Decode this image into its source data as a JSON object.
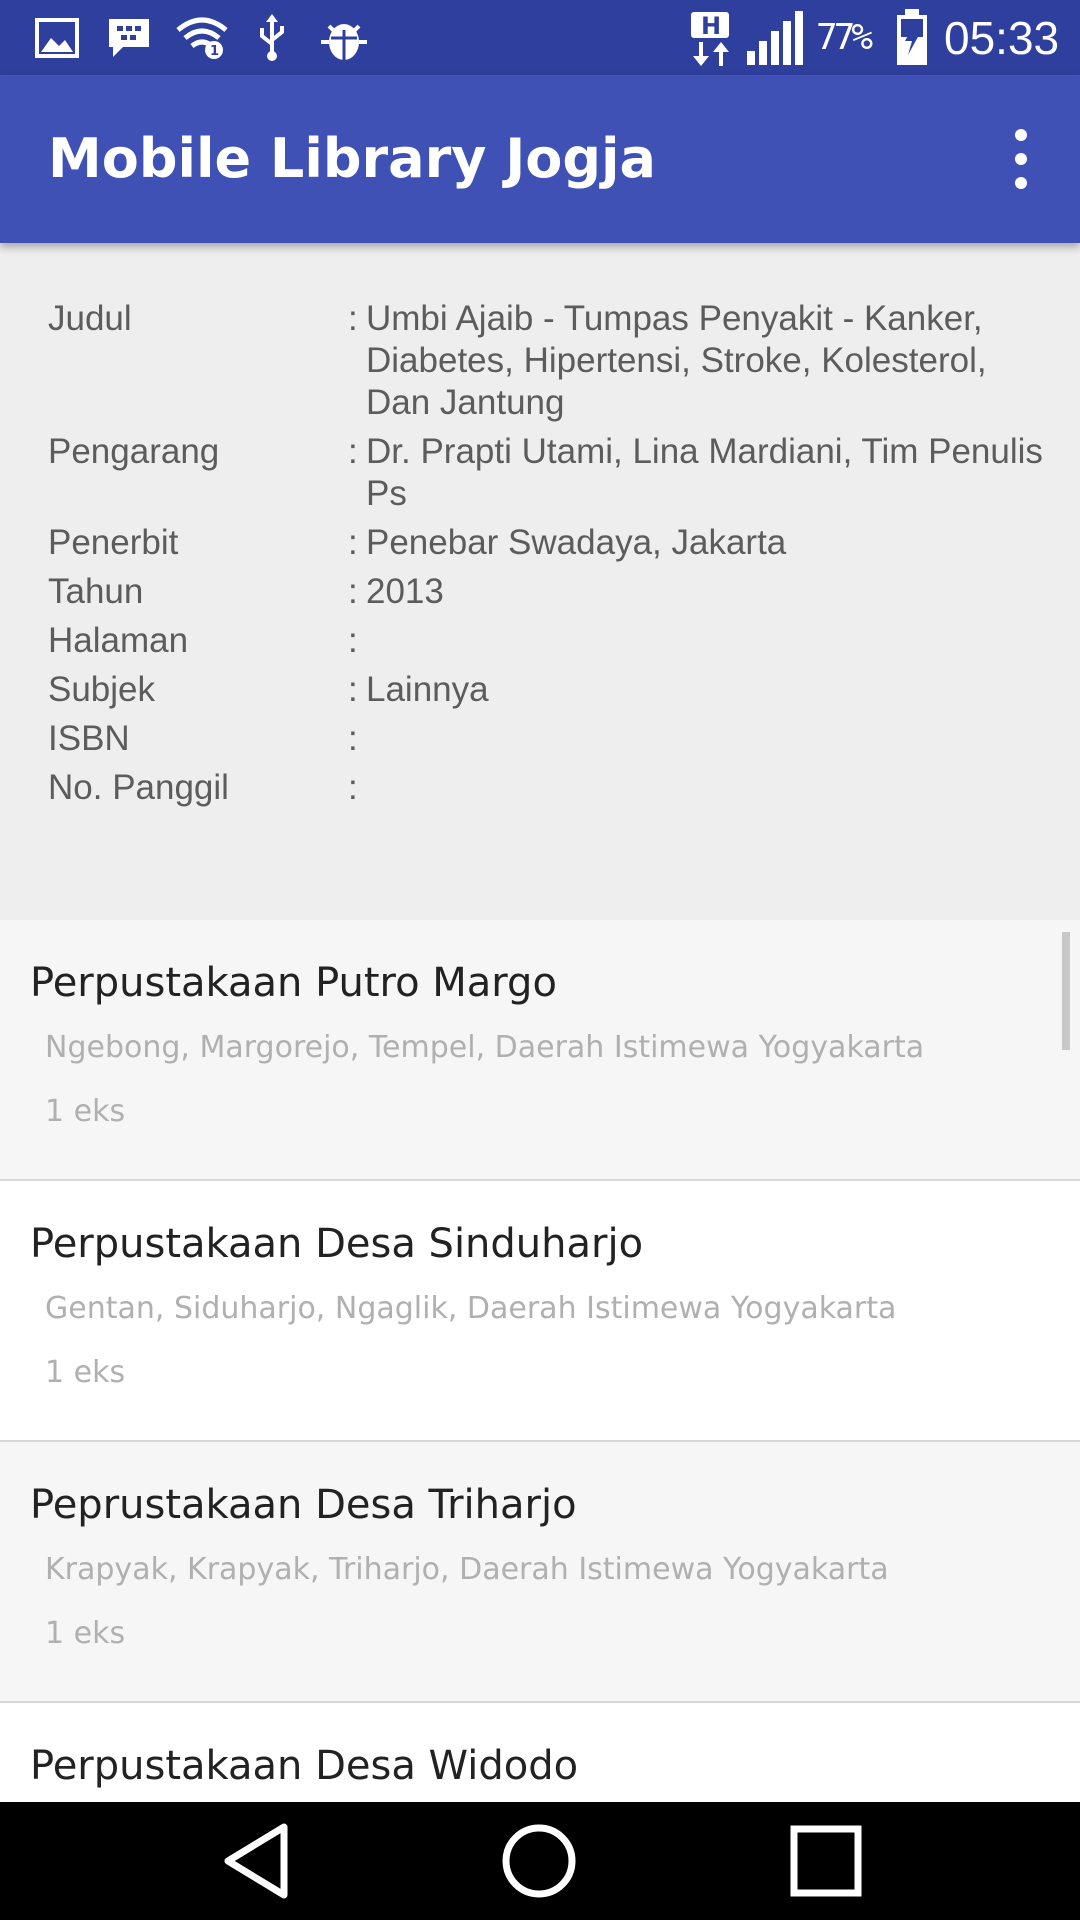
{
  "status_bar": {
    "battery": "77%",
    "time": "05:33",
    "network_type": "H",
    "icons": [
      "gallery-icon",
      "bbm-icon",
      "wifi-icon",
      "usb-icon",
      "bug-icon",
      "network-h-icon",
      "signal-icon",
      "battery-icon"
    ]
  },
  "app_bar": {
    "title": "Mobile Library Jogja",
    "menu_icon": "overflow-menu-icon"
  },
  "book": {
    "rows": [
      {
        "label": "Judul",
        "value": "Umbi Ajaib - Tumpas Penyakit - Kanker, Diabetes, Hipertensi, Stroke, Kolesterol, Dan Jantung"
      },
      {
        "label": "Pengarang",
        "value": "Dr. Prapti Utami, Lina Mardiani, Tim Penulis Ps"
      },
      {
        "label": "Penerbit",
        "value": "Penebar Swadaya, Jakarta"
      },
      {
        "label": "Tahun",
        "value": "2013"
      },
      {
        "label": "Halaman",
        "value": ""
      },
      {
        "label": "Subjek",
        "value": "Lainnya"
      },
      {
        "label": "ISBN",
        "value": ""
      },
      {
        "label": "No. Panggil",
        "value": ""
      }
    ],
    "separator": ":"
  },
  "libraries": [
    {
      "name": "Perpustakaan Putro Margo",
      "address": "Ngebong, Margorejo, Tempel, Daerah Istimewa Yogyakarta",
      "count": "1 eks"
    },
    {
      "name": "Perpustakaan Desa Sinduharjo",
      "address": "Gentan, Siduharjo, Ngaglik, Daerah Istimewa Yogyakarta",
      "count": "1 eks"
    },
    {
      "name": "Peprustakaan Desa Triharjo",
      "address": "Krapyak, Krapyak, Triharjo, Daerah Istimewa Yogyakarta",
      "count": "1 eks"
    },
    {
      "name": "Perpustakaan Desa Widodo",
      "address": "",
      "count": ""
    }
  ],
  "nav_bar": {
    "icons": [
      "back-icon",
      "home-icon",
      "recents-icon"
    ]
  },
  "colors": {
    "status_bar": "#2f3f9e",
    "app_bar": "#3f51b5",
    "nav_bar": "#000000"
  }
}
